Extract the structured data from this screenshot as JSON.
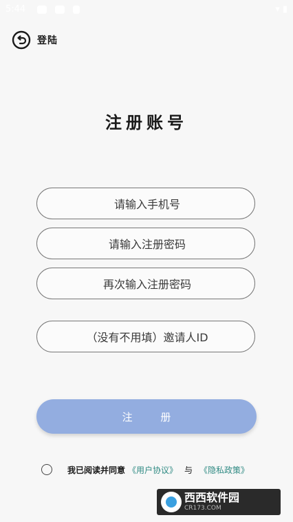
{
  "status_bar": {
    "time": "5:44",
    "icons_left": [
      "square-icon",
      "square-icon",
      "square-icon",
      "notification-icon"
    ],
    "icons_right": [
      "wifi-icon",
      "signal-icon",
      "battery-icon"
    ]
  },
  "header": {
    "back_label": "登陆"
  },
  "title": "注册账号",
  "form": {
    "phone_placeholder": "请输入手机号",
    "password_placeholder": "请输入注册密码",
    "confirm_placeholder": "再次输入注册密码",
    "invite_placeholder": "（没有不用填）邀请人ID"
  },
  "register_button": "注 册",
  "agreement": {
    "prefix": "我已阅读并同意",
    "user_agreement": "《用户协议》",
    "connector": "与",
    "privacy_policy": "《隐私政策》"
  },
  "watermark": {
    "title": "西西软件园",
    "sub": "CR173.COM"
  },
  "colors": {
    "accent": "#93ade0",
    "link": "#2f8a83",
    "background": "#f7f7f7"
  }
}
